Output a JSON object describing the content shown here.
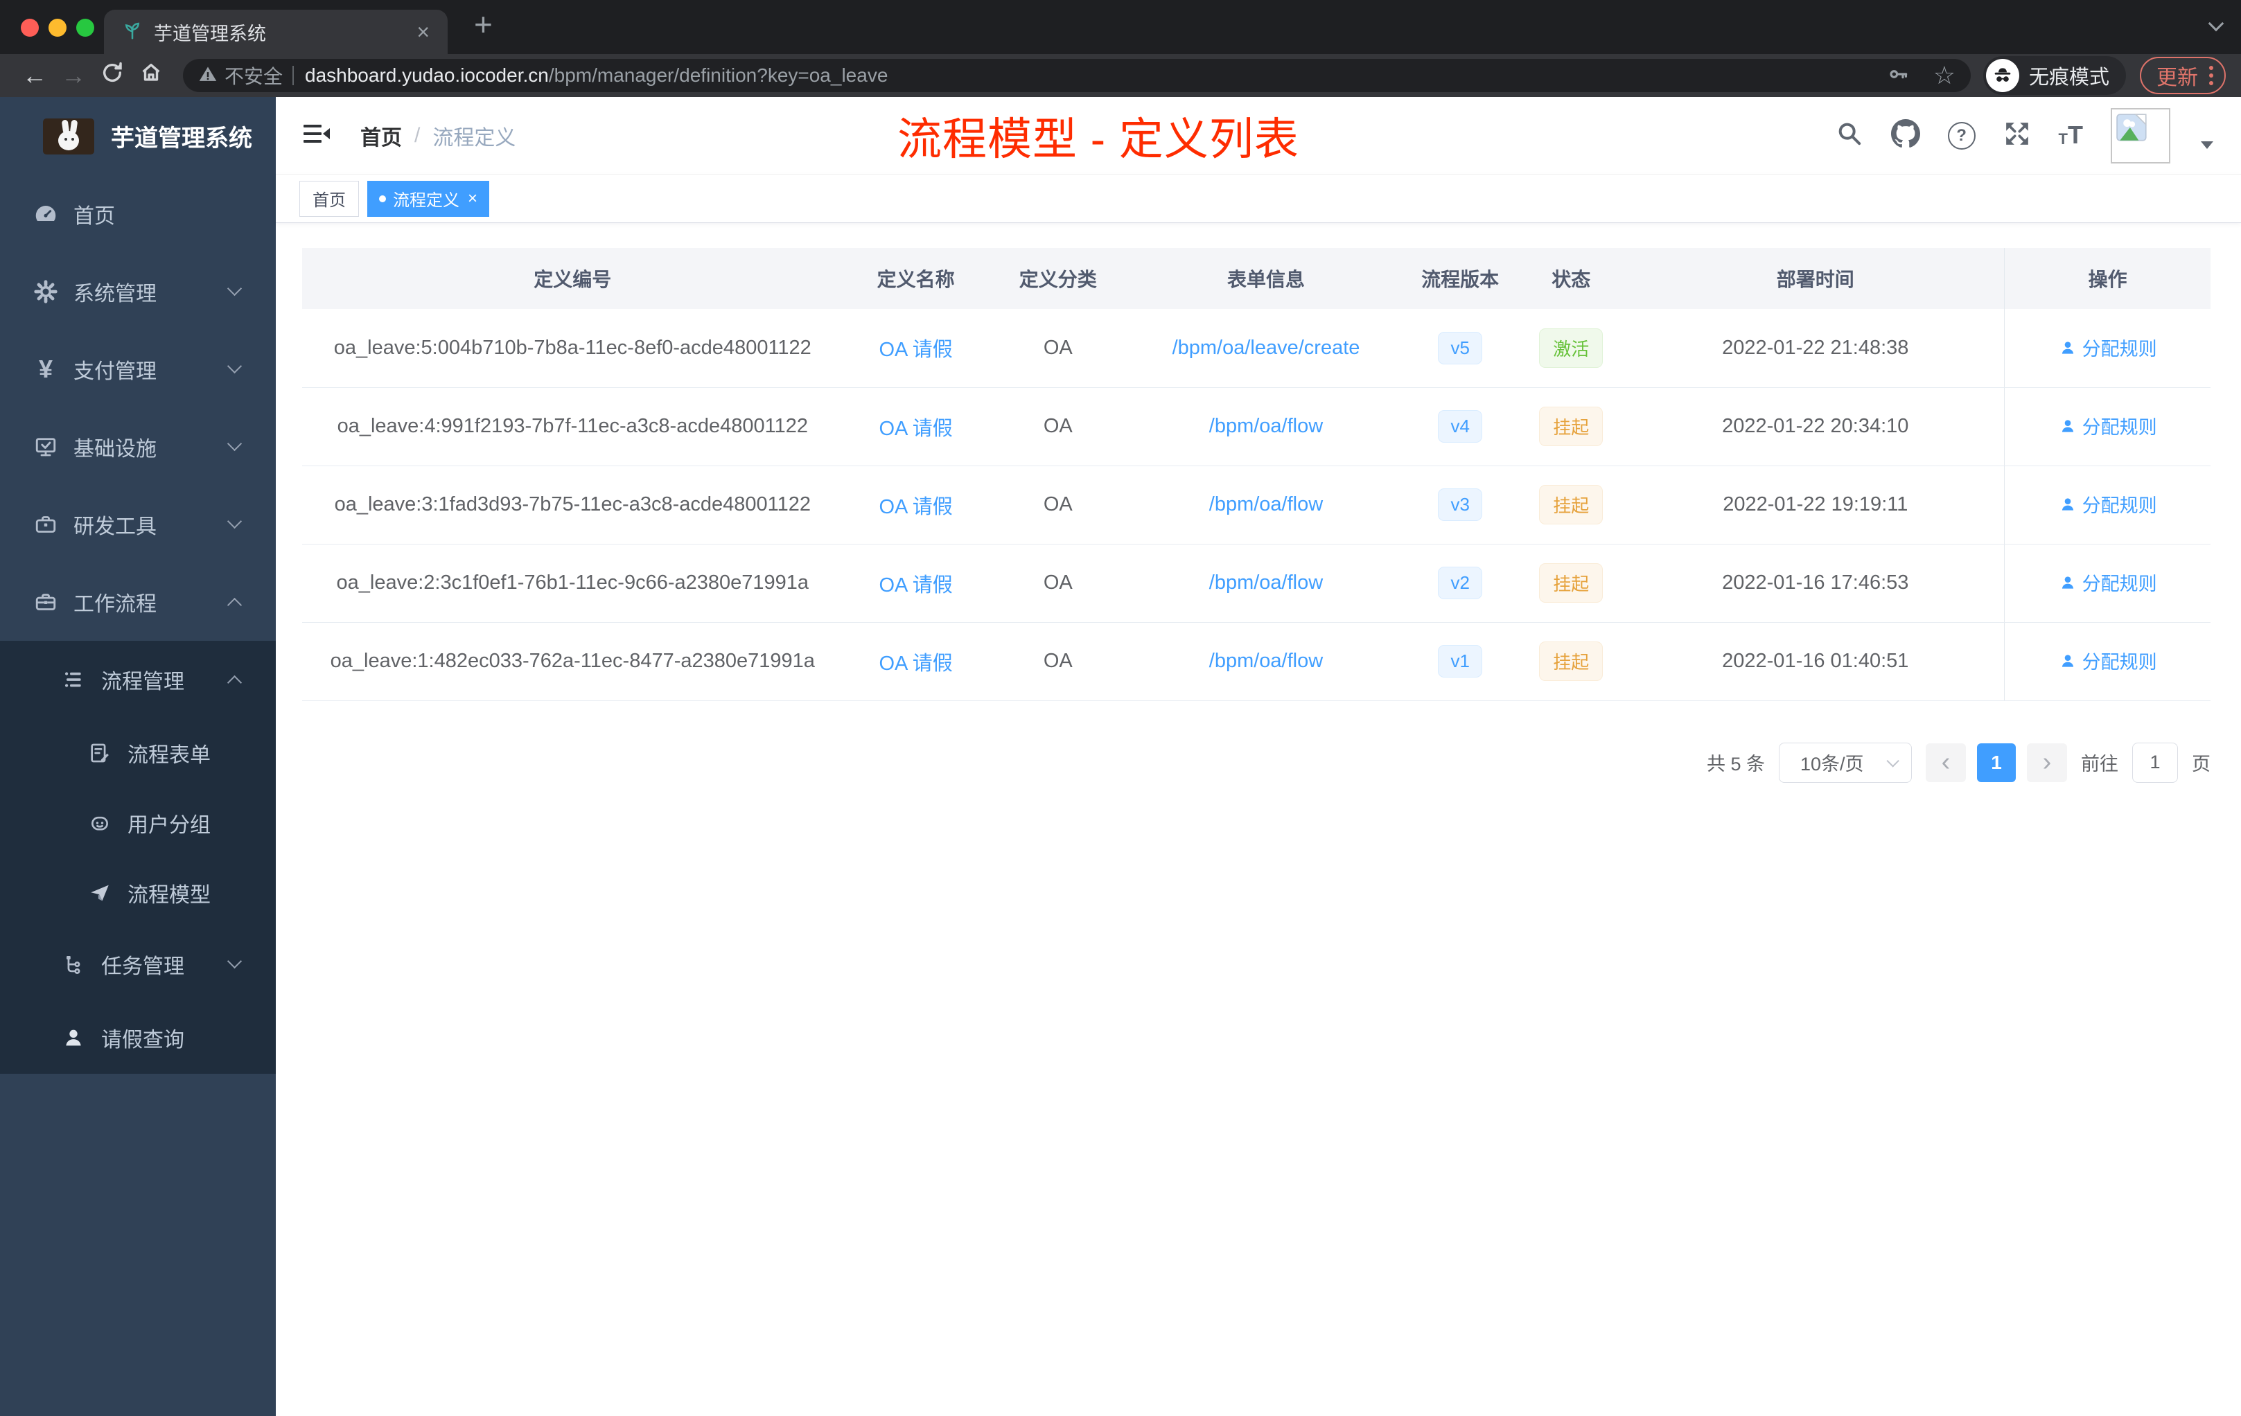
{
  "browser": {
    "tab_title": "芋道管理系统",
    "security_label": "不安全",
    "url_host": "dashboard.yudao.iocoder.cn",
    "url_path": "/bpm/manager/definition?key=oa_leave",
    "incognito_label": "无痕模式",
    "update_label": "更新",
    "glyphs": {
      "close": "×",
      "new_tab": "+",
      "back": "←",
      "forward": "→",
      "star": "☆"
    }
  },
  "sidebar": {
    "logo_title": "芋道管理系统",
    "items": [
      {
        "label": "首页"
      },
      {
        "label": "系统管理"
      },
      {
        "label": "支付管理"
      },
      {
        "label": "基础设施"
      },
      {
        "label": "研发工具"
      },
      {
        "label": "工作流程"
      },
      {
        "label": "流程管理"
      },
      {
        "label": "流程表单"
      },
      {
        "label": "用户分组"
      },
      {
        "label": "流程模型"
      },
      {
        "label": "任务管理"
      },
      {
        "label": "请假查询"
      }
    ],
    "yen_glyph": "¥"
  },
  "header": {
    "breadcrumb": {
      "home": "首页",
      "separator": "/",
      "current": "流程定义"
    },
    "help_glyph": "?",
    "font_small": "T",
    "font_big": "T"
  },
  "annotation": {
    "title": "流程模型 - 定义列表",
    "color": "#fe2c00"
  },
  "tags": {
    "home": "首页",
    "active": "流程定义",
    "close_glyph": "×"
  },
  "table": {
    "columns": [
      "定义编号",
      "定义名称",
      "定义分类",
      "表单信息",
      "流程版本",
      "状态",
      "部署时间",
      "操作"
    ],
    "rows": [
      {
        "id": "oa_leave:5:004b710b-7b8a-11ec-8ef0-acde48001122",
        "name": "OA 请假",
        "category": "OA",
        "form": "/bpm/oa/leave/create",
        "version": "v5",
        "status": "激活",
        "time": "2022-01-22 21:48:38",
        "action": "分配规则"
      },
      {
        "id": "oa_leave:4:991f2193-7b7f-11ec-a3c8-acde48001122",
        "name": "OA 请假",
        "category": "OA",
        "form": "/bpm/oa/flow",
        "version": "v4",
        "status": "挂起",
        "time": "2022-01-22 20:34:10",
        "action": "分配规则"
      },
      {
        "id": "oa_leave:3:1fad3d93-7b75-11ec-a3c8-acde48001122",
        "name": "OA 请假",
        "category": "OA",
        "form": "/bpm/oa/flow",
        "version": "v3",
        "status": "挂起",
        "time": "2022-01-22 19:19:11",
        "action": "分配规则"
      },
      {
        "id": "oa_leave:2:3c1f0ef1-76b1-11ec-9c66-a2380e71991a",
        "name": "OA 请假",
        "category": "OA",
        "form": "/bpm/oa/flow",
        "version": "v2",
        "status": "挂起",
        "time": "2022-01-16 17:46:53",
        "action": "分配规则"
      },
      {
        "id": "oa_leave:1:482ec033-762a-11ec-8477-a2380e71991a",
        "name": "OA 请假",
        "category": "OA",
        "form": "/bpm/oa/flow",
        "version": "v1",
        "status": "挂起",
        "time": "2022-01-16 01:40:51",
        "action": "分配规则"
      }
    ]
  },
  "pagination": {
    "total": "共 5 条",
    "page_size": "10条/页",
    "prev_glyph": "‹",
    "current_page": "1",
    "next_glyph": "›",
    "goto_label": "前往",
    "goto_value": "1",
    "page_unit": "页"
  },
  "colors": {
    "accent_blue": "#409eff",
    "annotation_red": "#fe2c00",
    "status_active_green": "#67c23a",
    "status_suspend_orange": "#e6a23c",
    "sidebar_bg": "#304156",
    "submenu_bg": "#1f2d3d"
  }
}
